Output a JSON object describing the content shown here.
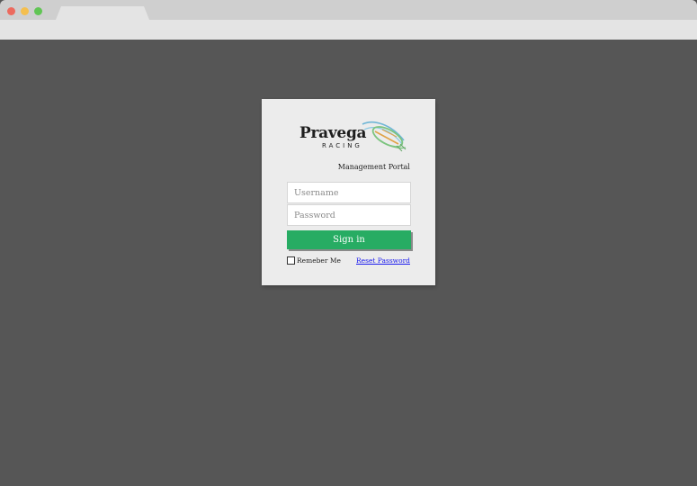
{
  "brand": {
    "name": "Pravega",
    "subtitle": "RACING",
    "logo_icon": "rugby-ball-swoosh-icon"
  },
  "portal_label": "Management Portal",
  "form": {
    "username_placeholder": "Username",
    "username_value": "",
    "password_placeholder": "Password",
    "password_value": "",
    "signin_label": "Sign in",
    "remember_label": "Remeber Me",
    "remember_checked": false,
    "reset_label": "Reset Password"
  },
  "colors": {
    "background": "#565656",
    "card": "#ececec",
    "accent_green": "#27ac63",
    "link": "#1a1aee"
  }
}
